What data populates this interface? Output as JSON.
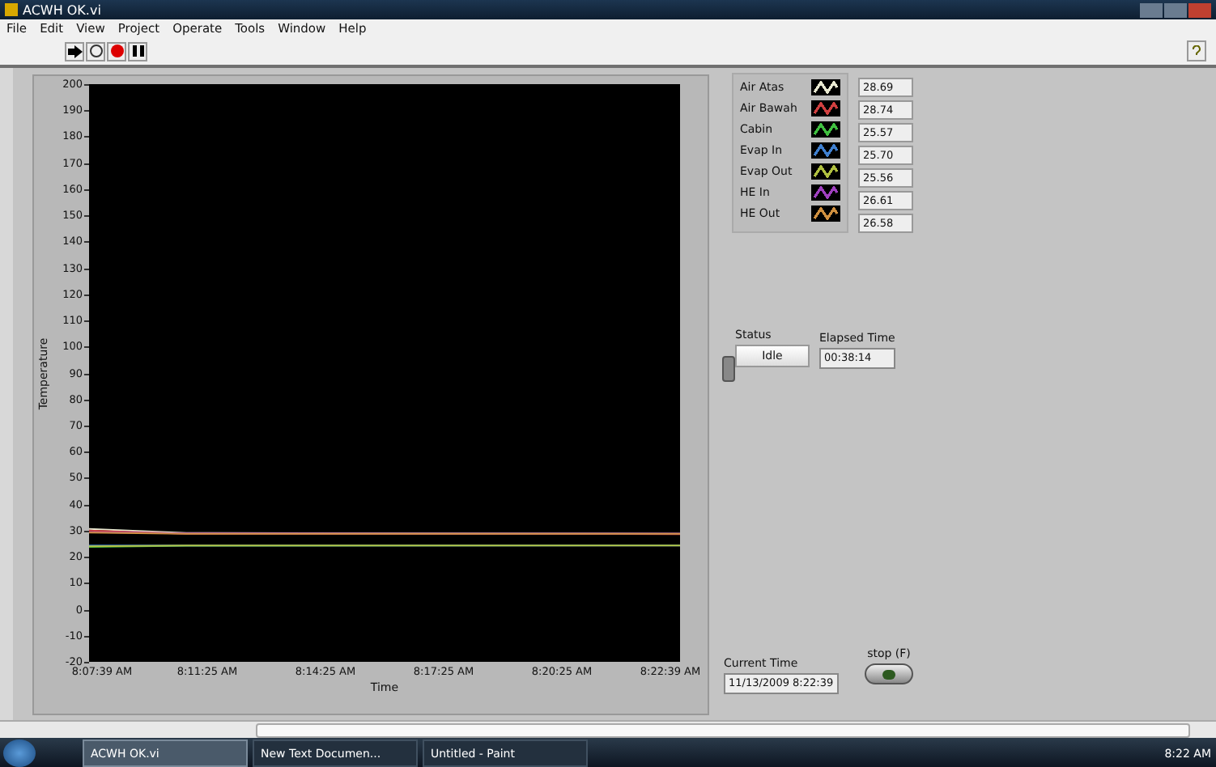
{
  "window": {
    "title": "ACWH OK.vi"
  },
  "menu": [
    "File",
    "Edit",
    "View",
    "Project",
    "Operate",
    "Tools",
    "Window",
    "Help"
  ],
  "chart": {
    "xlabel": "Time",
    "ylabel": "Temperature",
    "x_ticks": [
      "8:07:39 AM",
      "8:11:25 AM",
      "8:14:25 AM",
      "8:17:25 AM",
      "8:20:25 AM",
      "8:22:39 AM"
    ],
    "y_ticks": [
      "200",
      "190",
      "180",
      "170",
      "160",
      "150",
      "140",
      "130",
      "120",
      "110",
      "100",
      "90",
      "80",
      "70",
      "60",
      "50",
      "40",
      "30",
      "20",
      "10",
      "0",
      "-10",
      "-20"
    ]
  },
  "legend": [
    {
      "name": "Air Atas",
      "color": "#e8e8d0",
      "value": "28.69"
    },
    {
      "name": "Air Bawah",
      "color": "#d04040",
      "value": "28.74"
    },
    {
      "name": "Cabin",
      "color": "#40c040",
      "value": "25.57"
    },
    {
      "name": "Evap In",
      "color": "#4080d0",
      "value": "25.70"
    },
    {
      "name": "Evap Out",
      "color": "#b0c040",
      "value": "25.56"
    },
    {
      "name": "HE In",
      "color": "#a040c0",
      "value": "26.61"
    },
    {
      "name": "HE Out",
      "color": "#d09040",
      "value": "26.58"
    }
  ],
  "status": {
    "label": "Status",
    "value": "Idle"
  },
  "elapsed": {
    "label": "Elapsed Time",
    "value": "00:38:14"
  },
  "switch": {
    "on": false
  },
  "current_time": {
    "label": "Current Time",
    "value": "11/13/2009 8:22:39"
  },
  "stop": {
    "label": "stop (F)",
    "on": false
  },
  "taskbar": {
    "items": [
      {
        "label": "ACWH OK.vi",
        "selected": true
      },
      {
        "label": "New Text Documen...",
        "selected": false
      },
      {
        "label": "Untitled - Paint",
        "selected": false
      }
    ],
    "clock": "8:22 AM"
  }
}
